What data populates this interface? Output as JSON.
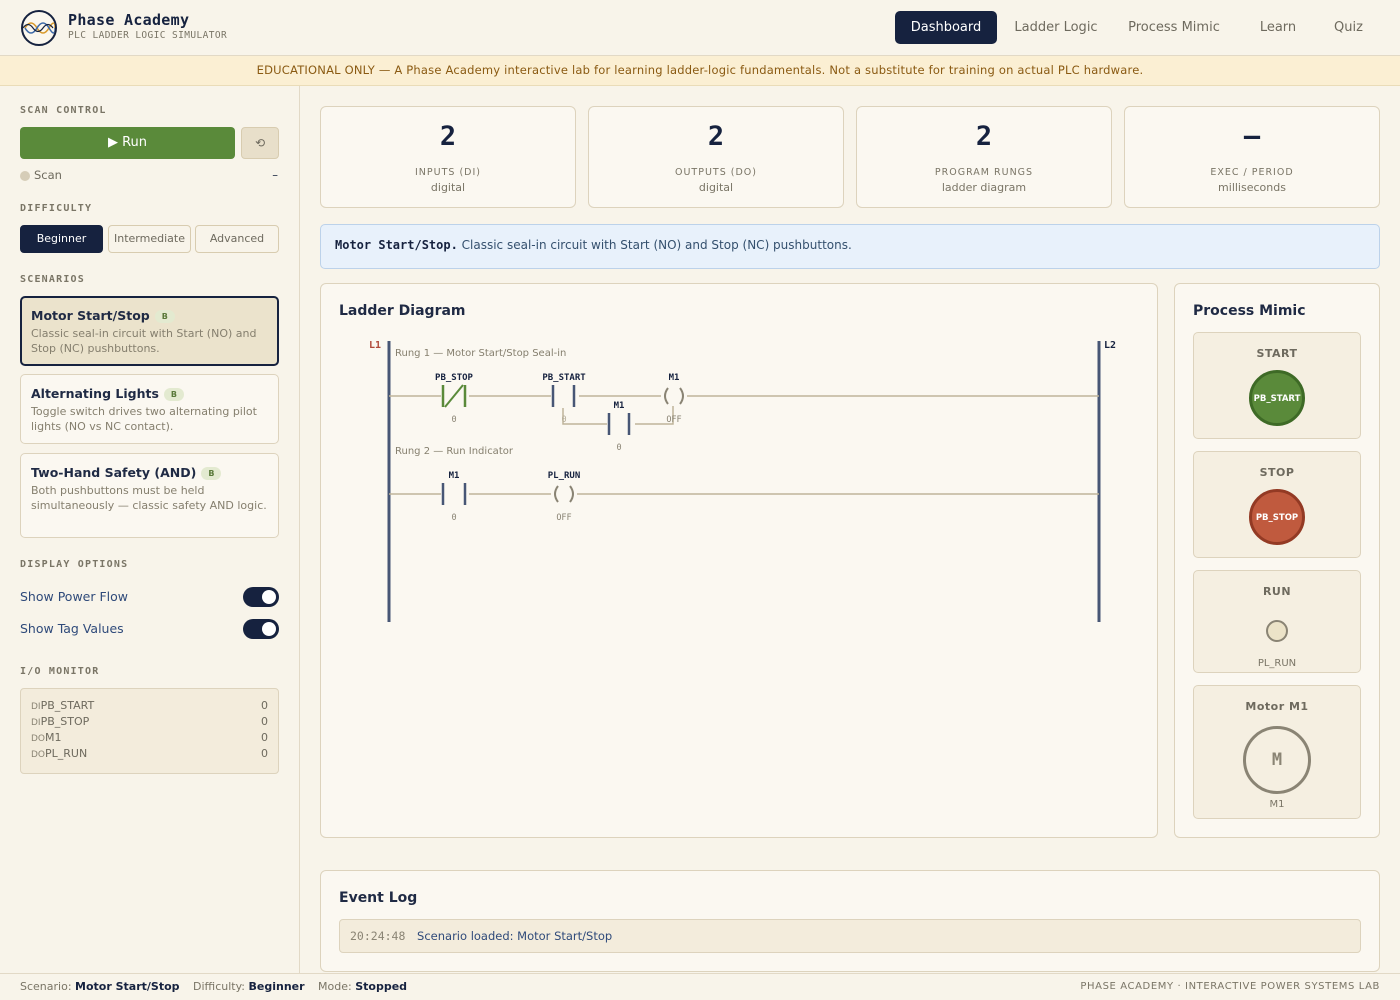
{
  "app": {
    "title": "Phase Academy",
    "subtitle": "PLC LADDER LOGIC SIMULATOR"
  },
  "nav": [
    "Dashboard",
    "Ladder Logic",
    "Process Mimic",
    "Learn",
    "Quiz"
  ],
  "banner": "EDUCATIONAL ONLY — A Phase Academy interactive lab for learning ladder-logic fundamentals. Not a substitute for training on actual PLC hardware.",
  "sidebar": {
    "scan_control": "SCAN CONTROL",
    "run_label": "▶ Run",
    "reset_label": "⟲",
    "scan_label": "Scan",
    "scan_value": "–",
    "difficulty_label": "DIFFICULTY",
    "difficulties": [
      "Beginner",
      "Intermediate",
      "Advanced"
    ],
    "scenarios_label": "SCENARIOS",
    "scenarios": [
      {
        "title": "Motor Start/Stop",
        "badge": "B",
        "desc": "Classic seal-in circuit with Start (NO) and Stop (NC) pushbuttons."
      },
      {
        "title": "Alternating Lights",
        "badge": "B",
        "desc": "Toggle switch drives two alternating pilot lights (NO vs NC contact)."
      },
      {
        "title": "Two-Hand Safety (AND)",
        "badge": "B",
        "desc": "Both pushbuttons must be held simultaneously — classic safety AND logic."
      }
    ],
    "display_label": "DISPLAY OPTIONS",
    "options": [
      {
        "label": "Show Power Flow",
        "on": true
      },
      {
        "label": "Show Tag Values",
        "on": true
      }
    ],
    "io_label": "I/O MONITOR",
    "io": [
      {
        "type": "DI",
        "tag": "PB_START",
        "value": "0"
      },
      {
        "type": "DI",
        "tag": "PB_STOP",
        "value": "0"
      },
      {
        "type": "DO",
        "tag": "M1",
        "value": "0"
      },
      {
        "type": "DO",
        "tag": "PL_RUN",
        "value": "0"
      }
    ]
  },
  "stats": [
    {
      "value": "2",
      "label": "INPUTS (DI)",
      "sub": "digital"
    },
    {
      "value": "2",
      "label": "OUTPUTS (DO)",
      "sub": "digital"
    },
    {
      "value": "2",
      "label": "PROGRAM RUNGS",
      "sub": "ladder diagram"
    },
    {
      "value": "–",
      "label": "EXEC / PERIOD",
      "sub": "milliseconds"
    }
  ],
  "info": {
    "title": "Motor Start/Stop.",
    "text": "Classic seal-in circuit with Start (NO) and Stop (NC) pushbuttons."
  },
  "ladder": {
    "title": "Ladder Diagram",
    "rail_left": "L1",
    "rail_right": "L2",
    "rungs": [
      {
        "label": "Rung 1 — Motor Start/Stop Seal-in",
        "elements": [
          {
            "tag": "PB_STOP",
            "kind": "NC contact",
            "value": "0"
          },
          {
            "tag": "PB_START",
            "kind": "NO contact",
            "value": "0"
          },
          {
            "tag": "M1",
            "kind": "coil",
            "value": "OFF"
          }
        ],
        "branch": {
          "tag": "M1",
          "kind": "NO contact",
          "value": "0"
        }
      },
      {
        "label": "Rung 2 — Run Indicator",
        "elements": [
          {
            "tag": "M1",
            "kind": "NO contact",
            "value": "0"
          },
          {
            "tag": "PL_RUN",
            "kind": "coil",
            "value": "OFF"
          }
        ]
      }
    ]
  },
  "mimic": {
    "title": "Process Mimic",
    "start": {
      "label": "START",
      "button": "PB_START"
    },
    "stop": {
      "label": "STOP",
      "button": "PB_STOP"
    },
    "run": {
      "label": "RUN",
      "tag": "PL_RUN"
    },
    "motor": {
      "label": "Motor M1",
      "symbol": "M",
      "tag": "M1"
    }
  },
  "event_log": {
    "title": "Event Log",
    "entries": [
      {
        "time": "20:24:48",
        "message": "Scenario loaded: Motor Start/Stop"
      }
    ]
  },
  "footer": {
    "scenario_key": "Scenario:",
    "scenario": "Motor Start/Stop",
    "difficulty_key": "Difficulty:",
    "difficulty": "Beginner",
    "mode_key": "Mode:",
    "mode": "Stopped",
    "right": "PHASE ACADEMY · INTERACTIVE POWER SYSTEMS LAB"
  },
  "colors": {
    "navy": "#16223f",
    "green": "#5a8a3a",
    "red": "#c05a3e",
    "cream": "#f8f4ea",
    "banner": "#fbefd3"
  }
}
